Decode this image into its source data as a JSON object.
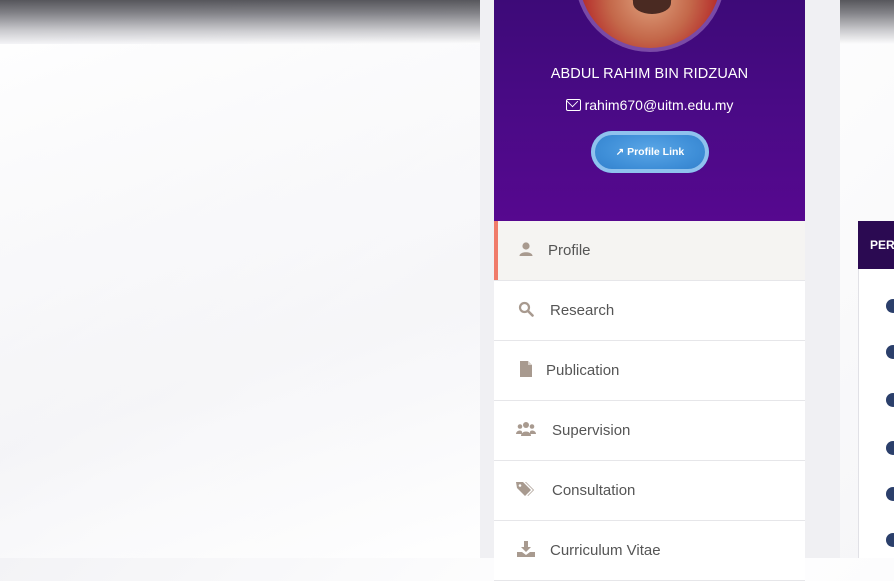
{
  "profile": {
    "name": "ABDUL RAHIM BIN RIDZUAN",
    "email": "rahim670@uitm.edu.my",
    "profile_link_label": "Profile Link"
  },
  "menu": {
    "items": [
      {
        "label": "Profile",
        "icon": "user-icon",
        "active": true
      },
      {
        "label": "Research",
        "icon": "search-icon",
        "active": false
      },
      {
        "label": "Publication",
        "icon": "file-icon",
        "active": false
      },
      {
        "label": "Supervision",
        "icon": "users-icon",
        "active": false
      },
      {
        "label": "Consultation",
        "icon": "tags-icon",
        "active": false
      },
      {
        "label": "Curriculum Vitae",
        "icon": "download-icon",
        "active": false
      }
    ]
  },
  "right_panel": {
    "header_text": "PER"
  },
  "colors": {
    "header_purple": "#4a0a86",
    "active_accent": "#f07b6a",
    "button_blue": "#3f8fd8",
    "icon_color": "#a89a8f"
  }
}
